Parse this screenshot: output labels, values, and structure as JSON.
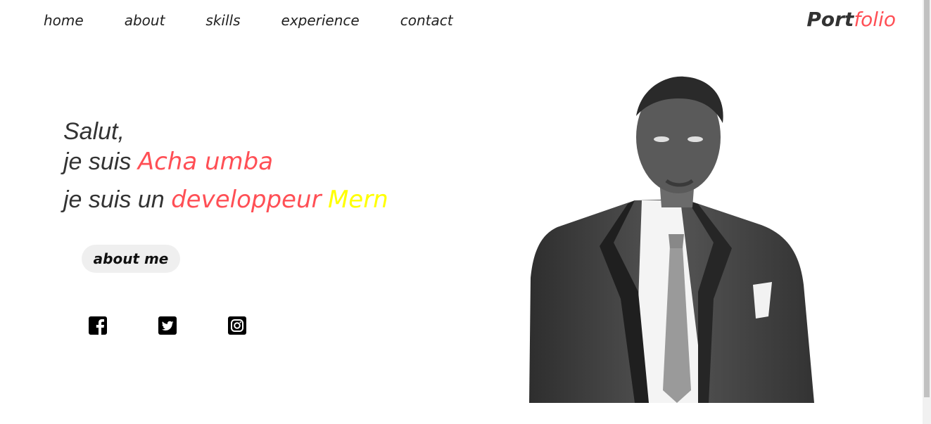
{
  "nav": {
    "items": [
      {
        "label": "home"
      },
      {
        "label": "about"
      },
      {
        "label": "skills"
      },
      {
        "label": "experience"
      },
      {
        "label": "contact"
      }
    ]
  },
  "logo": {
    "part1": "Port",
    "part2": "folio"
  },
  "hero": {
    "greeting": "Salut,",
    "intro_prefix": "je suis",
    "name": "Acha umba",
    "role_prefix": "je suis un",
    "role": "developpeur",
    "stack": "Mern"
  },
  "button": {
    "about_label": "about me"
  },
  "social": [
    "facebook-icon",
    "twitter-icon",
    "instagram-icon"
  ],
  "colors": {
    "accent": "#ff4f55",
    "highlight": "#ffff00",
    "text": "#333333",
    "button_bg": "#efefef"
  }
}
